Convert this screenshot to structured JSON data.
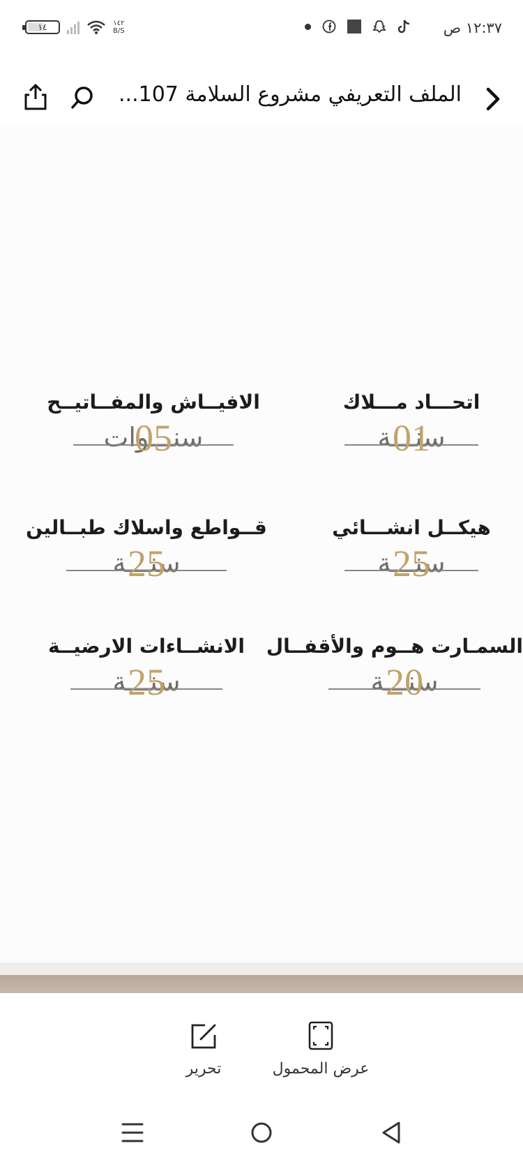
{
  "status_bar": {
    "time": "١٢:٣٧ ص",
    "battery": "١٤",
    "net_speed_value": "١٤٢",
    "net_speed_unit": "B/S"
  },
  "header": {
    "title": "الملف التعريفي مشروع السلامة 107..."
  },
  "items": [
    {
      "title": "اتحـــاد مـــلاك",
      "word": "سنـــة",
      "number": "01"
    },
    {
      "title": "الافيــاش  والمفــاتيــح",
      "word": "سنـــوات",
      "number": "05"
    },
    {
      "title": "هيكــل انشـــائي",
      "word": "سنـــة",
      "number": "25"
    },
    {
      "title": "قــواطع واسلاك طبــالين",
      "word": "سنـــة",
      "number": "25"
    },
    {
      "title": "السمـارت هــوم والأقفــال",
      "word": "سنـــة",
      "number": "20"
    },
    {
      "title": "الانشــاءات الارضيــة",
      "word": "سنـــة",
      "number": "25"
    }
  ],
  "toolbar": {
    "landscape_label": "عرض المحمول",
    "edit_label": "تحرير"
  },
  "colors": {
    "accent_gold": "#c1a36a",
    "strip_brown": "#b8a79a"
  }
}
